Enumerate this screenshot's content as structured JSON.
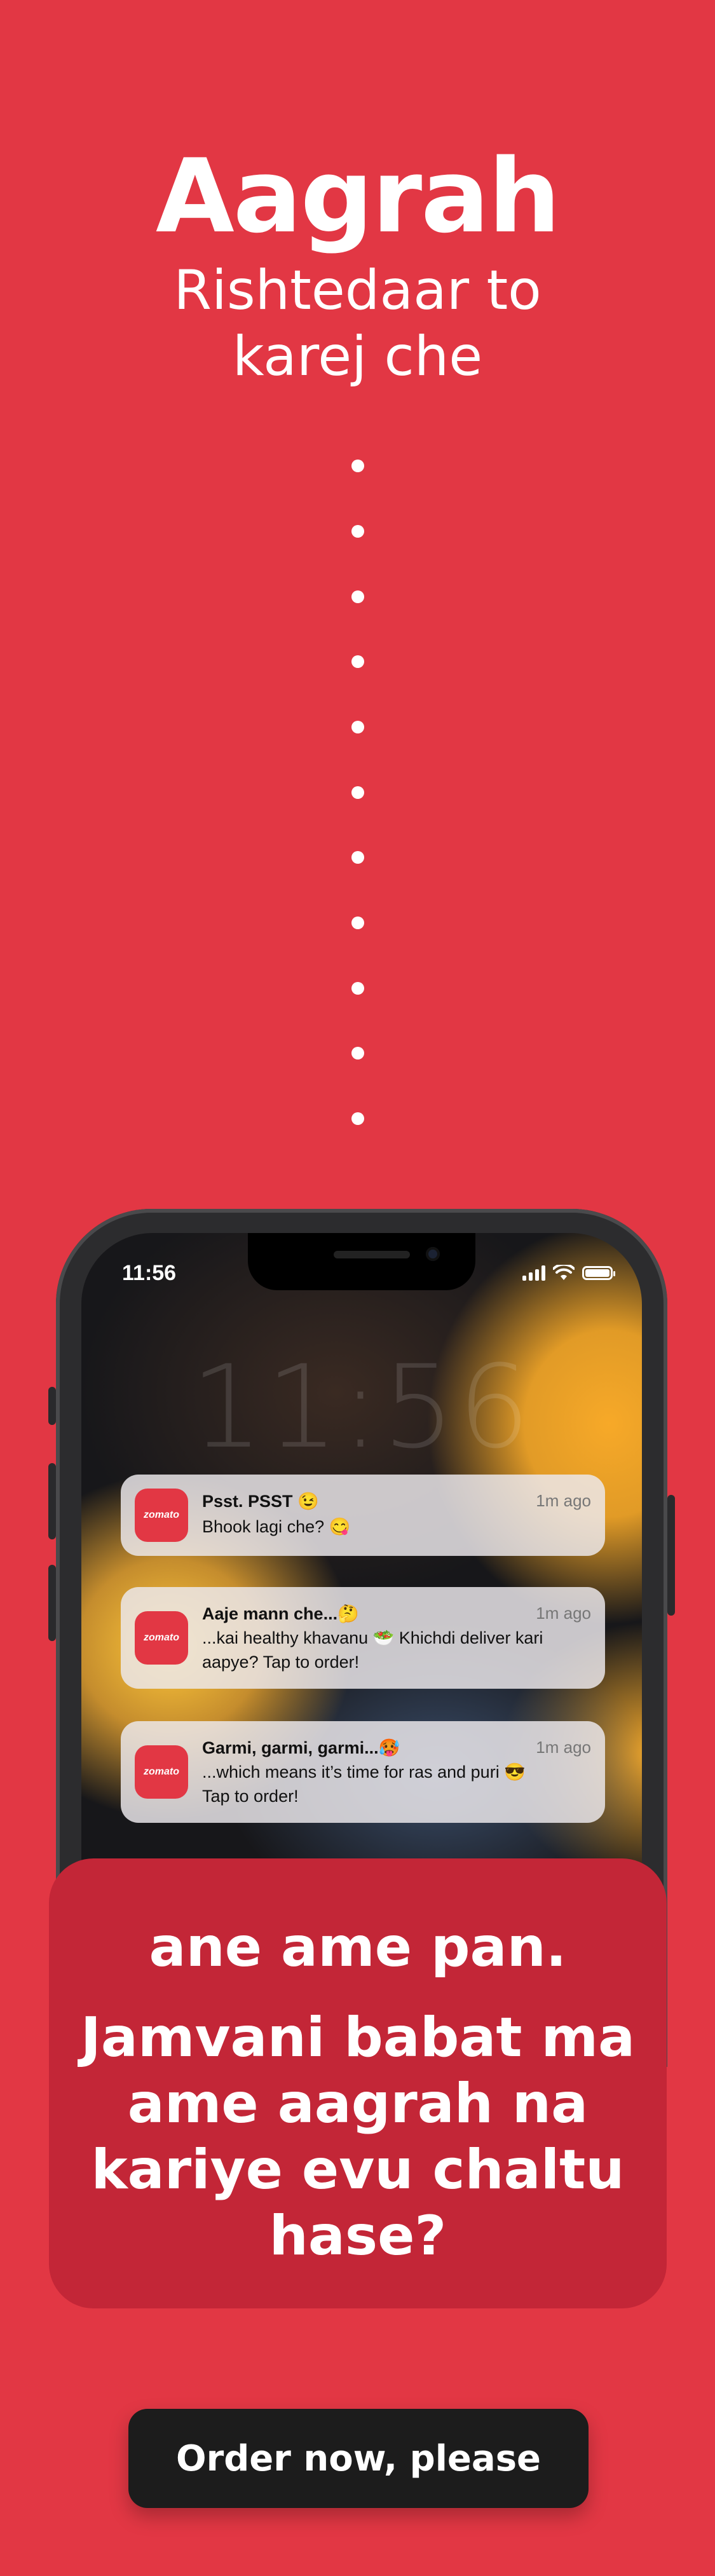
{
  "header": {
    "title": "Aagrah",
    "subtitle_line1": "Rishtedaar to",
    "subtitle_line2": "karej che"
  },
  "phone": {
    "status_time": "11:56",
    "lock_clock": "11:56",
    "notifications": [
      {
        "app": "zomato",
        "title": "Psst. PSST 😉",
        "body": [
          "Bhook lagi che? 😋"
        ],
        "time": "1m ago"
      },
      {
        "app": "zomato",
        "title": "Aaje mann che...🤔",
        "body": [
          "...kai healthy khavanu 🥗 Khichdi deliver kari",
          "aapye? Tap to order!"
        ],
        "time": "1m ago"
      },
      {
        "app": "zomato",
        "title": "Garmi, garmi, garmi...🥵",
        "body": [
          "...which means it’s time for ras and puri 😎",
          "Tap to order!"
        ],
        "time": "1m ago"
      }
    ]
  },
  "card": {
    "line1": "ane ame pan.",
    "line2": [
      "Jamvani babat ma",
      "ame aagrah na",
      "kariye evu chaltu",
      "hase?"
    ]
  },
  "cta": {
    "label": "Order now, please"
  },
  "colors": {
    "background": "#E23744",
    "card": "#C32637",
    "button": "#1c1c1c"
  }
}
